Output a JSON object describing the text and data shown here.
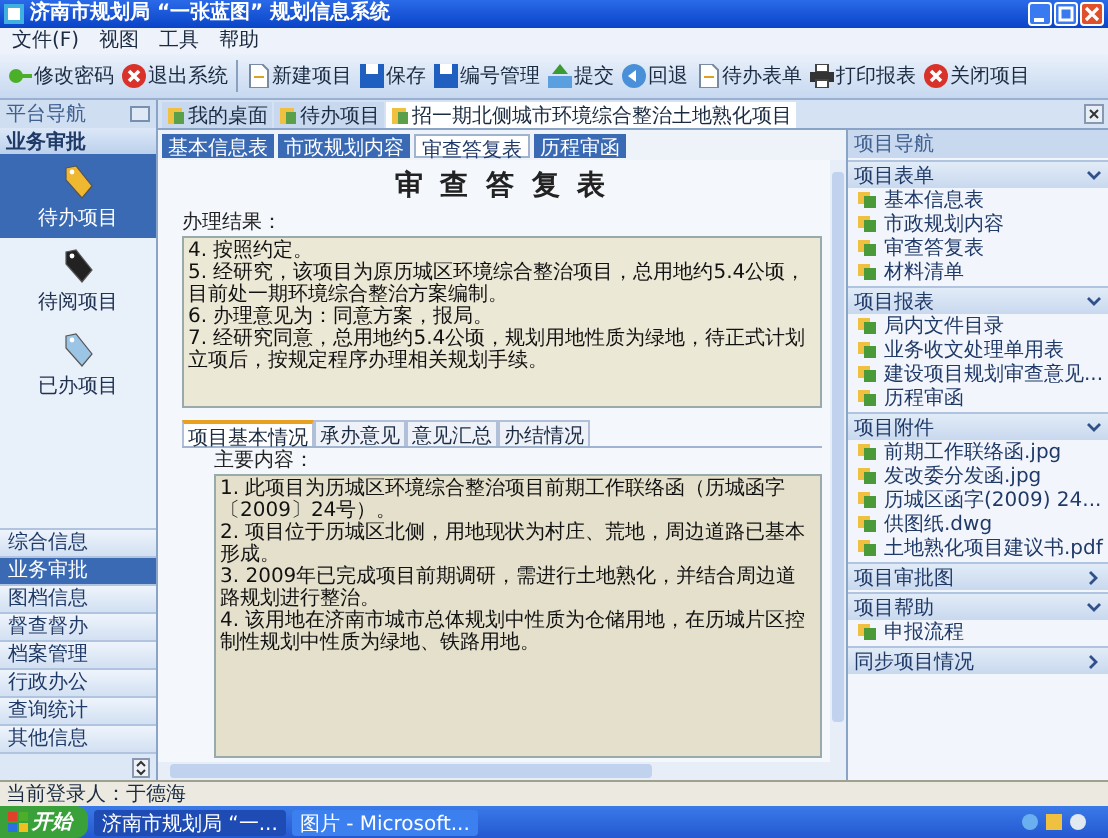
{
  "window": {
    "title": "济南市规划局 “一张蓝图” 规划信息系统"
  },
  "menu": [
    "文件(F)",
    "视图",
    "工具",
    "帮助"
  ],
  "toolbar": [
    {
      "label": "修改密码"
    },
    {
      "label": "退出系统"
    },
    {
      "label": "新建项目"
    },
    {
      "label": "保存"
    },
    {
      "label": "编号管理"
    },
    {
      "label": "提交"
    },
    {
      "label": "回退"
    },
    {
      "label": "待办表单"
    },
    {
      "label": "打印报表"
    },
    {
      "label": "关闭项目"
    }
  ],
  "sidebar": {
    "title": "平台导航",
    "section": "业务审批",
    "items": [
      {
        "label": "待办项目",
        "selected": true
      },
      {
        "label": "待阅项目",
        "selected": false
      },
      {
        "label": "已办项目",
        "selected": false
      }
    ],
    "nav": [
      {
        "label": "综合信息",
        "selected": false
      },
      {
        "label": "业务审批",
        "selected": true
      },
      {
        "label": "图档信息",
        "selected": false
      },
      {
        "label": "督查督办",
        "selected": false
      },
      {
        "label": "档案管理",
        "selected": false
      },
      {
        "label": "行政办公",
        "selected": false
      },
      {
        "label": "查询统计",
        "selected": false
      },
      {
        "label": "其他信息",
        "selected": false
      }
    ]
  },
  "doc_tabs": [
    {
      "label": "我的桌面",
      "selected": false
    },
    {
      "label": "待办项目",
      "selected": false
    },
    {
      "label": "招一期北侧城市环境综合整治土地熟化项目",
      "selected": true
    }
  ],
  "form_tabs": [
    {
      "label": "基本信息表",
      "selected": false
    },
    {
      "label": "市政规划内容",
      "selected": false
    },
    {
      "label": "审查答复表",
      "selected": true
    },
    {
      "label": "历程审函",
      "selected": false
    }
  ],
  "form": {
    "title": "审 查 答 复 表",
    "result_label": "办理结果：",
    "result_lines": [
      "4. 按照约定。",
      "5. 经研究，该项目为原历城区环境综合整治项目，总用地约5.4公顷，目前处一期环境综合整治方案编制。",
      "6. 办理意见为：同意方案，报局。",
      "7. 经研究同意，总用地约5.4公顷，规划用地性质为绿地，待正式计划立项后，按规定程序办理相关规划手续。"
    ]
  },
  "detail_tabs": [
    {
      "label": "项目基本情况",
      "selected": true
    },
    {
      "label": "承办意见",
      "selected": false
    },
    {
      "label": "意见汇总",
      "selected": false
    },
    {
      "label": "办结情况",
      "selected": false
    }
  ],
  "detail": {
    "label": "主要内容：",
    "lines": [
      "1. 此项目为历城区环境综合整治项目前期工作联络函（历城函字〔2009〕24号）。",
      "2. 项目位于历城区北侧，用地现状为村庄、荒地，周边道路已基本形成。",
      "3. 2009年已完成项目前期调研，需进行土地熟化，并结合周边道路规划进行整治。",
      "4. 该用地在济南市城市总体规划中性质为仓储用地，在历城片区控制性规划中性质为绿地、铁路用地。"
    ]
  },
  "project_nav": {
    "title": "项目导航",
    "sections": [
      {
        "title": "项目表单",
        "expanded": true,
        "items": [
          "基本信息表",
          "市政规划内容",
          "审查答复表",
          "材料清单"
        ]
      },
      {
        "title": "项目报表",
        "expanded": true,
        "items": [
          "局内文件目录",
          "业务收文处理单用表",
          "建设项目规划审查意见...",
          "历程审函"
        ]
      },
      {
        "title": "项目附件",
        "expanded": true,
        "items": [
          "前期工作联络函.jpg",
          "发改委分发函.jpg",
          "历城区函字(2009) 24...",
          "供图纸.dwg",
          "土地熟化项目建议书.pdf"
        ]
      },
      {
        "title": "项目审批图",
        "expanded": false
      },
      {
        "title": "项目帮助",
        "expanded": true,
        "items": [
          "申报流程"
        ]
      },
      {
        "title": "同步项目情况",
        "expanded": false
      }
    ]
  },
  "status_bar": {
    "user": "当前登录人：于德海"
  },
  "taskbar": {
    "start": "开始",
    "tasks": [
      {
        "label": "济南市规划局 “一...",
        "selected": true
      },
      {
        "label": "图片 - Microsoft...",
        "selected": false
      }
    ]
  }
}
